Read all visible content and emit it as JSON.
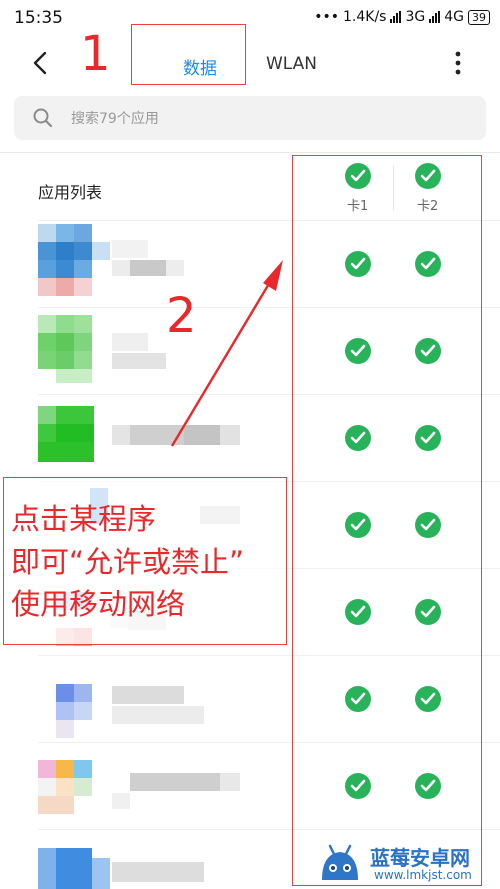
{
  "status_bar": {
    "time": "15:35",
    "dots": "•••",
    "net_speed": "1.4K/s",
    "net_3g": "3G",
    "net_4g": "4G",
    "battery": "39"
  },
  "nav": {
    "back_icon": "chevron-left-icon",
    "tabs": [
      "数据",
      "WLAN"
    ],
    "more_icon": "more-vertical-icon"
  },
  "search": {
    "placeholder": "搜索79个应用"
  },
  "list": {
    "title": "应用列表",
    "columns": [
      "卡1",
      "卡2"
    ],
    "rows_visible": 8,
    "sim1_allowed": [
      true,
      true,
      true,
      true,
      true,
      true,
      true
    ],
    "sim2_allowed": [
      true,
      true,
      true,
      true,
      true,
      true,
      true
    ]
  },
  "annotations": {
    "marker_1": "1",
    "marker_2": "2",
    "note_lines": [
      "点击某程序",
      "即可“允许或禁止”",
      "使用移动网络"
    ],
    "color": "#e8282a"
  },
  "watermark": {
    "title": "蓝莓安卓网",
    "url": "www.lmkjst.com"
  },
  "colors": {
    "accent": "#1a8be6",
    "check": "#28b35a"
  }
}
